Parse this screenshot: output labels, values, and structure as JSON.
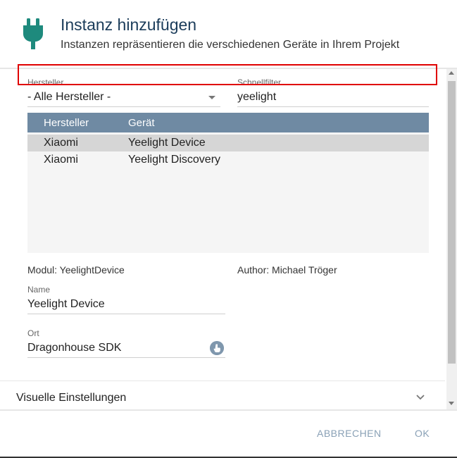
{
  "header": {
    "title": "Instanz hinzufügen",
    "subtitle": "Instanzen repräsentieren die verschiedenen Geräte in Ihrem Projekt",
    "icon": "plug-icon",
    "icon_color": "#1e8a7d"
  },
  "filters": {
    "manufacturer_label": "Hersteller",
    "manufacturer_value": "- Alle Hersteller -",
    "quickfilter_label": "Schnellfilter",
    "quickfilter_value": "yeelight"
  },
  "table": {
    "columns": [
      "Hersteller",
      "Gerät"
    ],
    "rows": [
      {
        "manufacturer": "Xiaomi",
        "device": "Yeelight Device",
        "selected": true
      },
      {
        "manufacturer": "Xiaomi",
        "device": "Yeelight Discovery",
        "selected": false
      }
    ]
  },
  "details": {
    "module": "Modul: YeelightDevice",
    "author": "Author: Michael Tröger",
    "name_label": "Name",
    "name_value": "Yeelight Device",
    "location_label": "Ort",
    "location_value": "Dragonhouse SDK",
    "location_icon": "location-picker-icon"
  },
  "section": {
    "title": "Visuelle Einstellungen"
  },
  "footer": {
    "cancel_label": "ABBRECHEN",
    "ok_label": "OK"
  },
  "colors": {
    "table_header": "#6f8aa3",
    "selected_row": "#d6d6d6",
    "highlight": "#e00000",
    "button_text": "#8aa1b6"
  }
}
